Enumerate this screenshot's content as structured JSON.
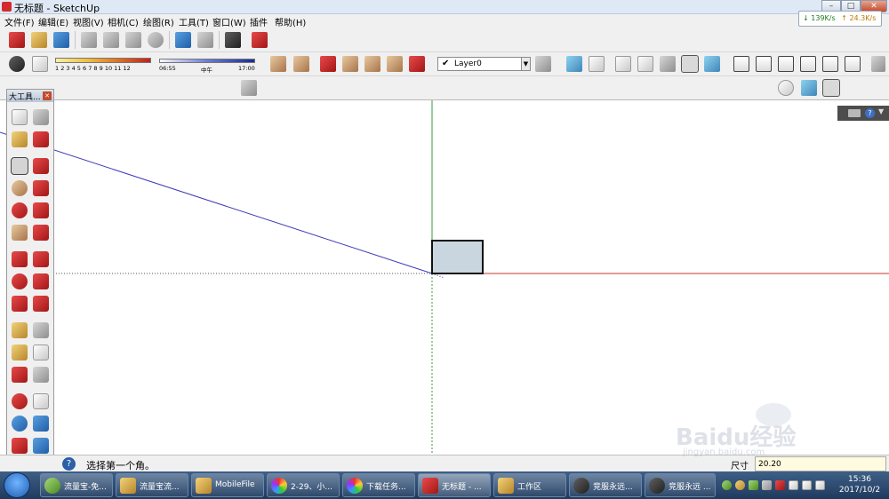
{
  "window": {
    "title": "无标题 - SketchUp",
    "minimize": "–",
    "maximize": "□",
    "close": "✕"
  },
  "menubar": [
    "文件(F)",
    "编辑(E)",
    "视图(V)",
    "相机(C)",
    "绘图(R)",
    "工具(T)",
    "窗口(W)",
    "插件",
    "帮助(H)"
  ],
  "netspeed": {
    "down": "139K/s",
    "up": "24.3K/s"
  },
  "toolbar_icons": {
    "row1": [
      "new-file-icon",
      "open-file-icon",
      "save-icon",
      "cut-icon",
      "copy-icon",
      "paste-icon",
      "erase-icon",
      "undo-icon",
      "redo-icon",
      "print-icon",
      "model-info-icon"
    ],
    "row2_left": [
      "shadow-toggle-icon",
      "fog-toggle-icon"
    ],
    "row2_styles": [
      "section-plane-icon",
      "display-section-icon",
      "x-ray-icon",
      "wireframe-icon",
      "hidden-line-icon",
      "shaded-icon",
      "shaded-texture-icon",
      "monochrome-icon"
    ],
    "row2_views": [
      "iso-view-icon",
      "top-view-icon",
      "front-view-icon",
      "right-view-icon",
      "back-view-icon",
      "left-view-icon"
    ]
  },
  "shadow_scale": {
    "ticks": "1 2 3 4 5 6 7 8 9 10 11 12"
  },
  "time_scale": {
    "start": "06:55",
    "mid": "中午",
    "end": "17:00"
  },
  "layer": {
    "checked": "✔",
    "name": "Layer0",
    "arrow": "▼"
  },
  "palette": {
    "title": "大工具...",
    "close": "✕",
    "tools": [
      "select-tool",
      "component-tool",
      "paint-bucket-tool",
      "eraser-tool",
      "rectangle-tool",
      "line-tool",
      "circle-tool",
      "freehand-tool",
      "polygon-tool",
      "arc-tool",
      "pie-tool",
      "arc3-tool",
      "move-tool",
      "push-pull-tool",
      "rotate-tool",
      "follow-me-tool",
      "scale-tool",
      "offset-tool",
      "tape-measure-tool",
      "dimension-tool",
      "protractor-tool",
      "text-tool",
      "axes-tool",
      "3d-text-tool",
      "orbit-tool",
      "pan-tool",
      "zoom-tool",
      "zoom-window-tool",
      "zoom-extents-tool",
      "previous-view-tool",
      "section-tool",
      "walk-tool"
    ]
  },
  "statusbar": {
    "help": "?",
    "message": "选择第一个角。",
    "vcb_label": "尺寸",
    "vcb_value": "20.20"
  },
  "taskbar": {
    "items": [
      {
        "label": "流量宝-免...",
        "icon": "liuliangbao-icon"
      },
      {
        "label": "流量宝流...",
        "icon": "folder-icon"
      },
      {
        "label": "MobileFile",
        "icon": "folder-icon"
      },
      {
        "label": "2-29、小...",
        "icon": "photo-viewer-icon"
      },
      {
        "label": "下载任务...",
        "icon": "photo-viewer-icon"
      },
      {
        "label": "无标题 - ...",
        "icon": "sketchup-icon"
      },
      {
        "label": "工作区",
        "icon": "workspace-icon"
      },
      {
        "label": "竞服永远...",
        "icon": "qq-icon"
      },
      {
        "label": "竞服永远 ...",
        "icon": "qq-icon"
      }
    ],
    "clock_time": "15:36",
    "clock_date": "2017/10/2"
  },
  "watermark": {
    "main": "Baidu经验",
    "sub": "jingyan.baidu.com"
  },
  "colors": {
    "axis_red": "#c0392b",
    "axis_green": "#3a9a3a",
    "axis_blue": "#3a3ab8",
    "rect_fill": "#c9d6e0"
  }
}
